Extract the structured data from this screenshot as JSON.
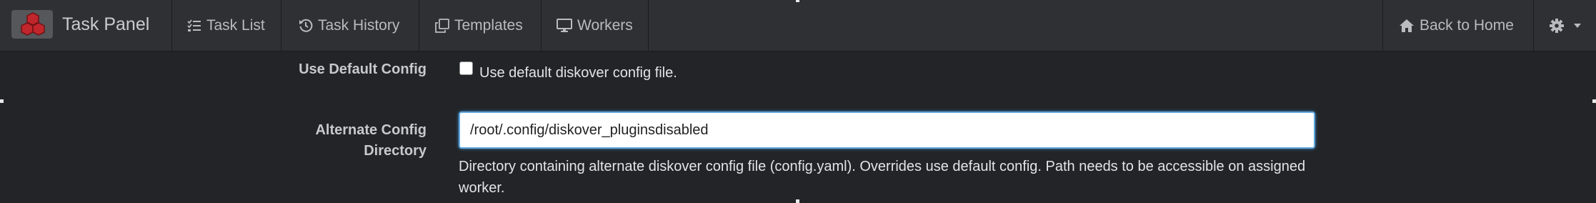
{
  "brand": {
    "title": "Task Panel",
    "logo_icon": "cubes-logo-icon"
  },
  "nav": {
    "items": [
      {
        "label": "Task List",
        "icon": "tasks-icon"
      },
      {
        "label": "Task History",
        "icon": "history-icon"
      },
      {
        "label": "Templates",
        "icon": "clone-icon"
      },
      {
        "label": "Workers",
        "icon": "desktop-icon"
      }
    ],
    "back_home": {
      "label": "Back to Home",
      "icon": "home-icon"
    },
    "settings_icon": "gear-icon"
  },
  "form": {
    "use_default_config": {
      "label": "Use Default Config",
      "checkbox_label": "Use default diskover config file.",
      "checked": false
    },
    "alt_config_dir": {
      "label_line1": "Alternate Config",
      "label_line2": "Directory",
      "value": "/root/.config/diskover_pluginsdisabled",
      "help": "Directory containing alternate diskover config file (config.yaml). Overrides use default config. Path needs to be accessible on assigned worker."
    }
  },
  "colors": {
    "navbar_bg": "#2e3034",
    "page_bg": "#222427",
    "logo_red": "#c0262b",
    "input_focus": "#62a8df"
  }
}
